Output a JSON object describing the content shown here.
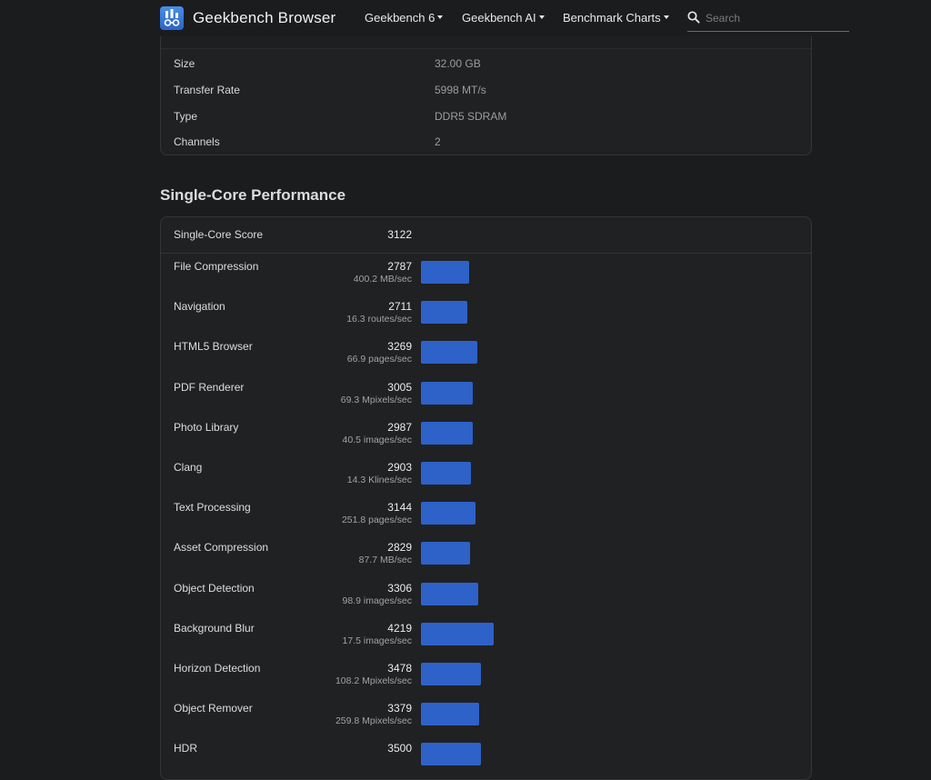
{
  "nav": {
    "brand": "Geekbench Browser",
    "menus": [
      "Geekbench 6",
      "Geekbench AI",
      "Benchmark Charts"
    ],
    "search_placeholder": "Search"
  },
  "memory": {
    "rows": [
      {
        "label": "Size",
        "value": "32.00 GB"
      },
      {
        "label": "Transfer Rate",
        "value": "5998 MT/s"
      },
      {
        "label": "Type",
        "value": "DDR5 SDRAM"
      },
      {
        "label": "Channels",
        "value": "2"
      }
    ]
  },
  "single_core": {
    "title": "Single-Core Performance",
    "score_label": "Single-Core Score",
    "score": "3122",
    "benchmarks": [
      {
        "name": "File Compression",
        "score": "2787",
        "rate": "400.2 MB/sec",
        "bar": 2787
      },
      {
        "name": "Navigation",
        "score": "2711",
        "rate": "16.3 routes/sec",
        "bar": 2711
      },
      {
        "name": "HTML5 Browser",
        "score": "3269",
        "rate": "66.9 pages/sec",
        "bar": 3269
      },
      {
        "name": "PDF Renderer",
        "score": "3005",
        "rate": "69.3 Mpixels/sec",
        "bar": 3005
      },
      {
        "name": "Photo Library",
        "score": "2987",
        "rate": "40.5 images/sec",
        "bar": 2987
      },
      {
        "name": "Clang",
        "score": "2903",
        "rate": "14.3 Klines/sec",
        "bar": 2903
      },
      {
        "name": "Text Processing",
        "score": "3144",
        "rate": "251.8 pages/sec",
        "bar": 3144
      },
      {
        "name": "Asset Compression",
        "score": "2829",
        "rate": "87.7 MB/sec",
        "bar": 2829
      },
      {
        "name": "Object Detection",
        "score": "3306",
        "rate": "98.9 images/sec",
        "bar": 3306
      },
      {
        "name": "Background Blur",
        "score": "4219",
        "rate": "17.5 images/sec",
        "bar": 4219
      },
      {
        "name": "Horizon Detection",
        "score": "3478",
        "rate": "108.2 Mpixels/sec",
        "bar": 3478
      },
      {
        "name": "Object Remover",
        "score": "3379",
        "rate": "259.8 Mpixels/sec",
        "bar": 3379
      },
      {
        "name": "HDR",
        "score": "3500",
        "rate": "",
        "bar": 3500
      }
    ]
  },
  "colors": {
    "background": "#1b1c1e",
    "card": "#202123",
    "bar": "#2e62c9"
  }
}
